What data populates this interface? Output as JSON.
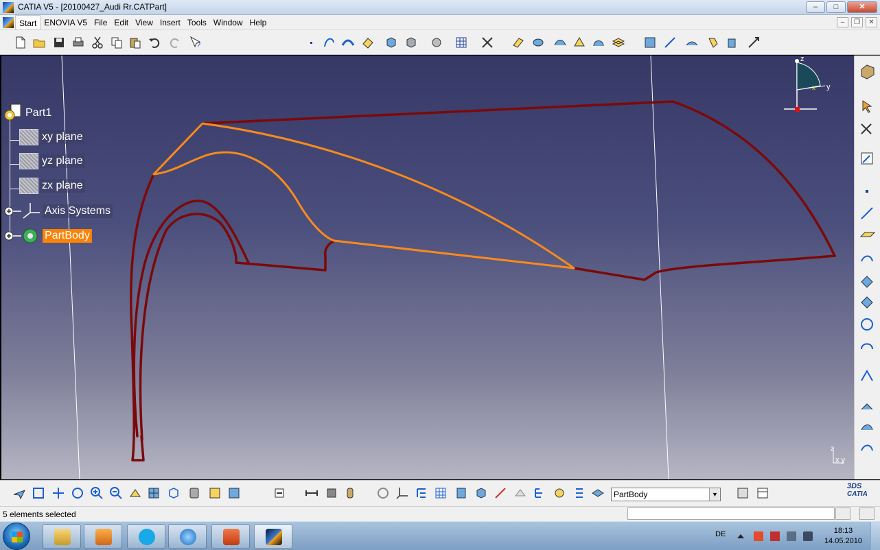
{
  "window": {
    "title": "CATIA V5 - [20100427_Audi Rr.CATPart]",
    "controls": [
      "minimize",
      "maximize",
      "close"
    ]
  },
  "menubar": {
    "items": [
      "Start",
      "ENOVIA V5",
      "File",
      "Edit",
      "View",
      "Insert",
      "Tools",
      "Window",
      "Help"
    ]
  },
  "tree": {
    "root": "Part1",
    "items": [
      {
        "label": "xy plane",
        "icon": "plane-icon"
      },
      {
        "label": "yz plane",
        "icon": "plane-icon"
      },
      {
        "label": "zx plane",
        "icon": "plane-icon"
      },
      {
        "label": "Axis Systems",
        "icon": "axis-system-icon"
      },
      {
        "label": "PartBody",
        "icon": "partbody-icon",
        "selected": true
      }
    ]
  },
  "compass": {
    "z_label": "z",
    "y_label": "y",
    "x_label": "x"
  },
  "view_axis": {
    "z_label": "z",
    "xy_label": "x y"
  },
  "geometry": {
    "colors": {
      "curve_dark": "#7a0a0a",
      "curve_selected": "#ff8a1a",
      "highlight": "#ff8200"
    }
  },
  "bottom_toolbar": {
    "current_body": "PartBody"
  },
  "branding": {
    "logo_text": "CATIA"
  },
  "status": {
    "message": "5 elements selected"
  },
  "taskbar": {
    "language": "DE",
    "time": "18:13",
    "date": "14.05.2010"
  }
}
